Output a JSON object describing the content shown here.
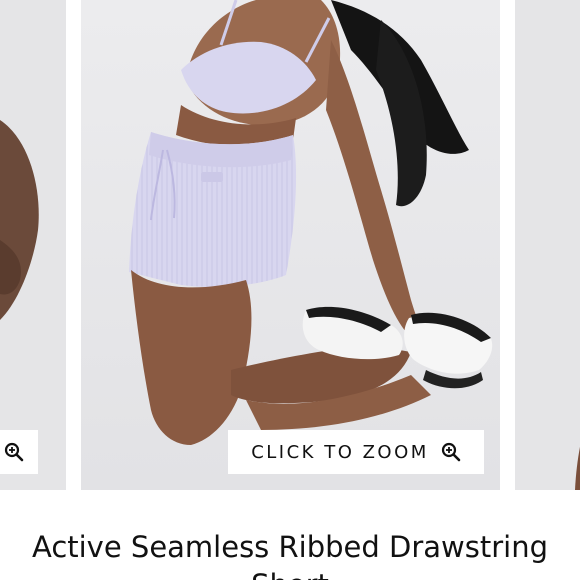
{
  "carousel": {
    "zoom_label": "CLICK TO ZOOM",
    "zoom_icon": "zoom-in-icon",
    "colors": {
      "slide_bg": "#e9e9eb",
      "button_bg": "#ffffff",
      "text": "#111111",
      "garment": "#d7d5ee"
    }
  },
  "product": {
    "title": "Active Seamless Ribbed Drawstring Short"
  }
}
